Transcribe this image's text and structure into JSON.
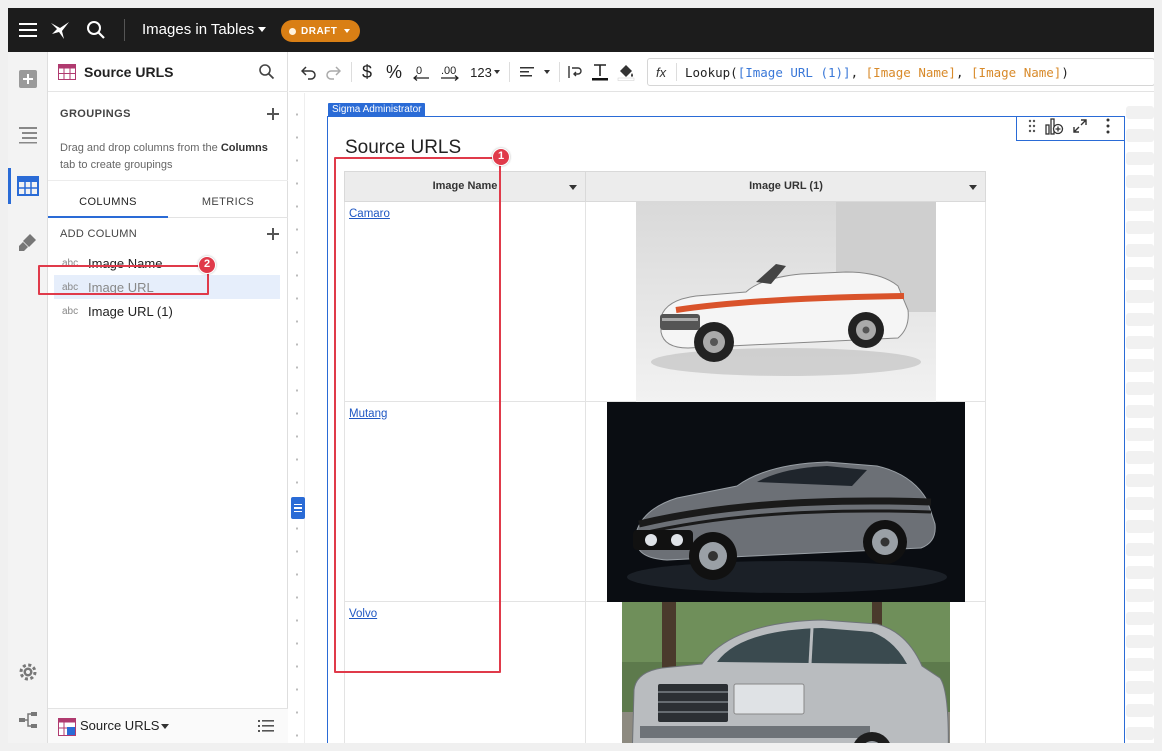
{
  "topbar": {
    "doc_title": "Images in Tables",
    "status_badge": "DRAFT"
  },
  "panel": {
    "title": "Source URLS",
    "groupings_header": "GROUPINGS",
    "groupings_hint_pre": "Drag and drop columns from the ",
    "groupings_hint_bold": "Columns",
    "groupings_hint_post": " tab to create groupings",
    "tabs": [
      {
        "label": "COLUMNS",
        "active": true
      },
      {
        "label": "METRICS",
        "active": false
      }
    ],
    "add_column_label": "ADD COLUMN",
    "columns": [
      {
        "type": "abc",
        "label": "Image Name",
        "selected": false
      },
      {
        "type": "abc",
        "label": "Image URL",
        "selected": true
      },
      {
        "type": "abc",
        "label": "Image URL (1)",
        "selected": false
      }
    ],
    "footer_label": "Source URLS"
  },
  "toolbar": {
    "dollar": "$",
    "percent": "%",
    "number_format": "123",
    "fx": "fx"
  },
  "formula": {
    "fn": "Lookup(",
    "arg1": "[Image URL (1)]",
    "sep1": ", ",
    "arg2": "[Image Name]",
    "sep2": ", ",
    "arg3": "[Image Name]",
    "close": ")"
  },
  "element": {
    "owner_tag": "Sigma Administrator",
    "title": "Source URLS",
    "columns": [
      "Image Name",
      "Image URL (1)"
    ],
    "rows": [
      {
        "name": "Camaro",
        "image": "white-convertible-car"
      },
      {
        "name": "Mutang",
        "image": "grey-striped-muscle-car"
      },
      {
        "name": "Volvo",
        "image": "silver-sedan-car"
      }
    ]
  },
  "annotations": [
    {
      "number": "1",
      "color": "#e03a4a"
    },
    {
      "number": "2",
      "color": "#e03a4a"
    }
  ],
  "colors": {
    "accent": "#2a6bd6",
    "draft": "#d97f15",
    "annotation": "#e03a4a",
    "link": "#1f57c3"
  }
}
